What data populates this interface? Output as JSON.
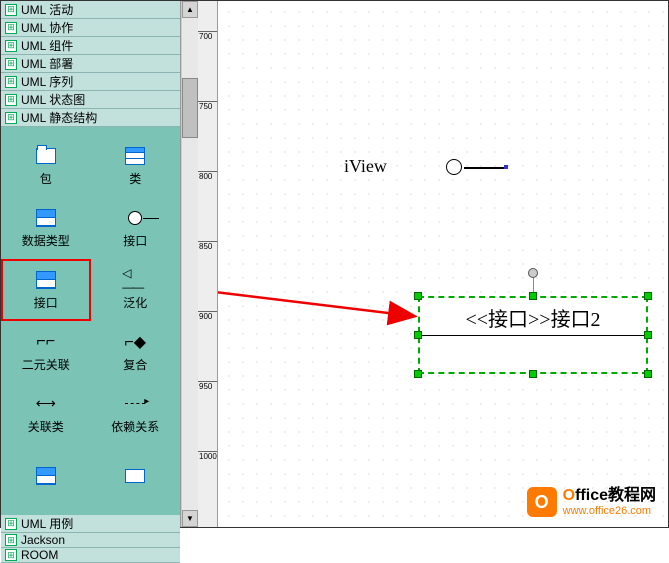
{
  "tree": {
    "items": [
      "UML 活动",
      "UML 协作",
      "UML 组件",
      "UML 部署",
      "UML 序列",
      "UML 状态图",
      "UML 静态结构",
      "UML 用例",
      "Jackson",
      "ROOM"
    ]
  },
  "shapes": {
    "package": "包",
    "class": "类",
    "datatype": "数据类型",
    "interface1": "接口",
    "interface2": "接口",
    "generalization": "泛化",
    "binary": "二元关联",
    "composition": "复合",
    "assoc_class": "关联类",
    "dependency": "依赖关系"
  },
  "canvas": {
    "iview_label": "iView",
    "interface_stereotype": "<<接口>>",
    "interface_name": "接口2"
  },
  "watermark": {
    "brand_prefix": "O",
    "brand_rest": "ffice教程网",
    "url": "www.office26.com",
    "icon_text": "O"
  },
  "ruler": {
    "marks": [
      "700",
      "750",
      "800",
      "850",
      "900",
      "950",
      "1000"
    ]
  }
}
